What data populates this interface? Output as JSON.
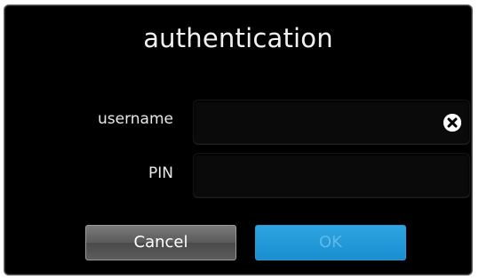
{
  "dialog": {
    "title": "authentication"
  },
  "form": {
    "username_label": "username",
    "username_value": "",
    "pin_label": "PIN",
    "pin_value": ""
  },
  "buttons": {
    "cancel_label": "Cancel",
    "ok_label": "OK"
  },
  "icons": {
    "clear": "close-circle-icon"
  },
  "colors": {
    "dialog_background": "#000000",
    "ok_button": "#1a8fd0",
    "ok_button_text_disabled": "#5fb9e8",
    "cancel_button": "#5a5a5a"
  }
}
